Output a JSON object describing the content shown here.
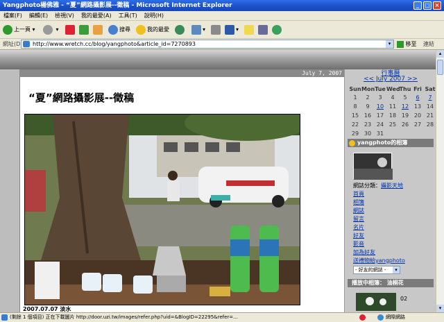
{
  "window": {
    "title": "Yangphoto楊佛雅 - “夏”網路攝影展--徵稿 - Microsoft Internet Explorer"
  },
  "menu": [
    "檔案(F)",
    "編輯(E)",
    "檢視(V)",
    "我的最愛(A)",
    "工具(T)",
    "說明(H)"
  ],
  "toolbar": {
    "back": "上一頁",
    "search": "搜尋",
    "favorites": "我的最愛"
  },
  "address": {
    "label": "網址(D)",
    "url": "http://www.wretch.cc/blog/yangphoto&article_id=7270893",
    "go": "移至",
    "links": "連結"
  },
  "blog": {
    "date": "July 7, 2007",
    "post_title": "“夏”網路攝影展--徵稿",
    "caption": "2007.07.07 淡水"
  },
  "sidebar": {
    "home": "行事曆",
    "month": "<< July 2007 >>",
    "weekdays": [
      "Sun",
      "Mon",
      "Tue",
      "Wed",
      "Thu",
      "Fri",
      "Sat"
    ],
    "days": [
      [
        "1",
        "2",
        "3",
        "4",
        "5",
        "6",
        "7"
      ],
      [
        "8",
        "9",
        "10",
        "11",
        "12",
        "13",
        "14"
      ],
      [
        "15",
        "16",
        "17",
        "18",
        "19",
        "20",
        "21"
      ],
      [
        "22",
        "23",
        "24",
        "25",
        "26",
        "27",
        "28"
      ],
      [
        "29",
        "30",
        "31",
        "",
        "",
        "",
        ""
      ]
    ],
    "album_head": "yangphoto的相簿",
    "category_label": "網誌分類：",
    "category_value": "攝影天地",
    "links": [
      "首頁",
      "相簿",
      "網誌",
      "留言",
      "名片",
      "好友",
      "影音",
      "加為好友",
      "送禮物給yangphoto"
    ],
    "friends_select": "- 好友的網誌 -",
    "music_head": "播放中相簿： 油桐花",
    "music_num": "02"
  },
  "status": {
    "text": "(剩餘 1 個項目) 正在下載圖片 http://door.uzi.tw/images/refer.php?uid=&BlogID=22295&refer=...",
    "zone": "網際網路"
  }
}
